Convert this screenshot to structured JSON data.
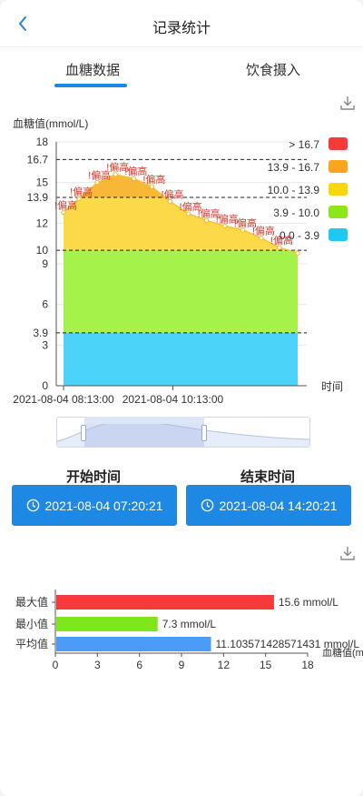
{
  "nav": {
    "title": "记录统计"
  },
  "tabs": [
    {
      "label": "血糖数据",
      "active": true
    },
    {
      "label": "饮食摄入",
      "active": false
    }
  ],
  "icons": {
    "back": "chevron-left-icon",
    "download": "download-icon",
    "clock": "clock-icon"
  },
  "time_range": {
    "start_label": "开始时间",
    "end_label": "结束时间",
    "start_value": "2021-08-04 07:20:21",
    "end_value": "2021-08-04 14:20:21"
  },
  "legend": [
    {
      "label": "> 16.7",
      "color": "#f63a3a"
    },
    {
      "label": "13.9 - 16.7",
      "color": "#fba51c"
    },
    {
      "label": "10.0 - 13.9",
      "color": "#f9d70b"
    },
    {
      "label": "3.9 - 10.0",
      "color": "#8de61a"
    },
    {
      "label": "0.0 - 3.9",
      "color": "#1ec8f5"
    }
  ],
  "chart_data": [
    {
      "type": "area",
      "ylabel": "血糖值(mmol/L)",
      "xlabel": "时间",
      "ylim": [
        0,
        18
      ],
      "yticks": [
        "0",
        "3",
        "3.9",
        "6",
        "9",
        "10",
        "12",
        "13.9",
        "15",
        "16.7",
        "18"
      ],
      "xticks": [
        "2021-08-04 08:13:00",
        "2021-08-04 10:13:00"
      ],
      "reference_lines": [
        3.9,
        10,
        13.9,
        16.7
      ],
      "annotation_label": "!偏高",
      "series": [
        {
          "x": [
            "2021-08-04 08:13:00",
            "2021-08-04 08:30:00",
            "2021-08-04 08:50:00",
            "2021-08-04 09:10:00",
            "2021-08-04 09:30:00",
            "2021-08-04 09:50:00",
            "2021-08-04 10:10:00",
            "2021-08-04 10:30:00",
            "2021-08-04 10:50:00",
            "2021-08-04 11:10:00",
            "2021-08-04 11:30:00",
            "2021-08-04 11:50:00",
            "2021-08-04 12:10:00",
            "2021-08-04 12:30:00"
          ],
          "values": [
            12.8,
            13.8,
            15.0,
            15.6,
            15.3,
            14.7,
            13.6,
            12.7,
            12.2,
            11.8,
            11.5,
            10.9,
            10.2,
            9.8
          ]
        }
      ]
    },
    {
      "type": "bar",
      "orientation": "horizontal",
      "xlabel": "血糖值(mmol/L)",
      "xlim": [
        0,
        18
      ],
      "xticks": [
        "0",
        "3",
        "6",
        "9",
        "12",
        "15",
        "18"
      ],
      "categories": [
        "最大值",
        "最小值",
        "平均值"
      ],
      "values": [
        15.6,
        7.3,
        11.103571428571431
      ],
      "value_labels": [
        "15.6 mmol/L",
        "7.3 mmol/L",
        "11.103571428571431 mmol/L"
      ],
      "colors": [
        "#f63a3a",
        "#7ee619",
        "#4a9cf5"
      ]
    }
  ]
}
